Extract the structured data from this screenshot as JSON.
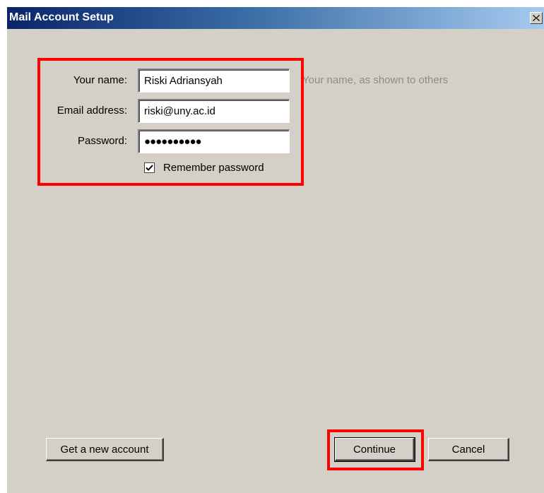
{
  "window": {
    "title": "Mail Account Setup",
    "close_glyph": "×"
  },
  "form": {
    "name": {
      "label": "Your name:",
      "value": "Riski Adriansyah",
      "hint": "Your name, as shown to others"
    },
    "email": {
      "label": "Email address:",
      "value": "riski@uny.ac.id"
    },
    "password": {
      "label": "Password:",
      "value": "●●●●●●●●●●"
    },
    "remember": {
      "label": "Remember password",
      "checked": true
    }
  },
  "buttons": {
    "get_account": "Get a new account",
    "continue": "Continue",
    "cancel": "Cancel"
  },
  "colors": {
    "highlight": "#ff0000",
    "title_bar_start": "#0a246a",
    "title_bar_end": "#a6caf0",
    "dialog_bg": "#d4d0c8"
  }
}
